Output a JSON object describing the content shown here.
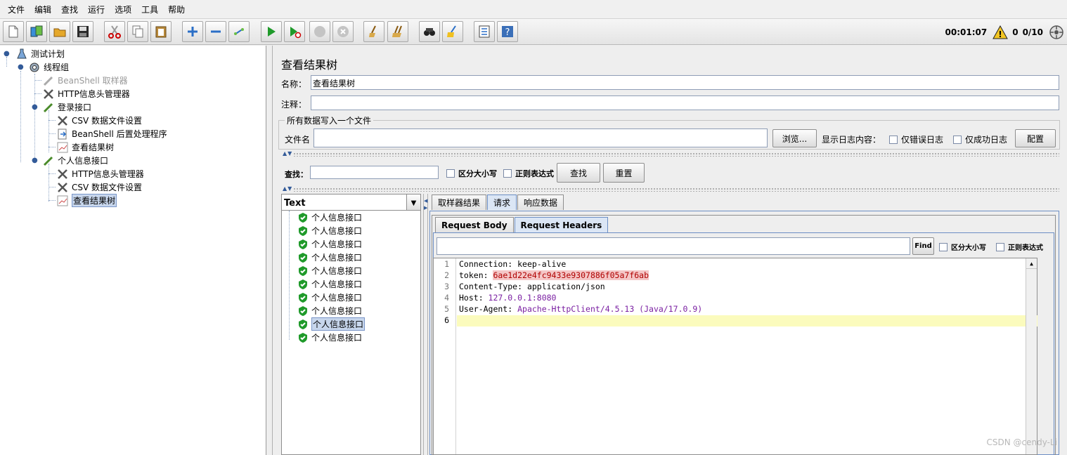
{
  "menu": [
    "文件",
    "编辑",
    "查找",
    "运行",
    "选项",
    "工具",
    "帮助"
  ],
  "toolbar": {
    "buttons": [
      "new-icon",
      "templates-icon",
      "open-icon",
      "save-icon",
      "cut-icon",
      "copy-icon",
      "paste-icon",
      "expand-icon",
      "collapse-icon",
      "toggle-icon",
      "start-icon",
      "start-no-pause-icon",
      "stop-icon",
      "shutdown-icon",
      "clear-icon",
      "clear-all-icon",
      "search-icon",
      "reset-search-icon",
      "function-helper-icon",
      "help-icon"
    ],
    "timer": "00:01:07",
    "warnings": "0",
    "threads": "0/10"
  },
  "tree": {
    "nodes": [
      {
        "label": "测试计划",
        "icon": "flask-icon",
        "depth": 0,
        "state": "normal"
      },
      {
        "label": "线程组",
        "icon": "gear-icon",
        "depth": 1,
        "state": "normal"
      },
      {
        "label": "BeanShell 取样器",
        "icon": "pipette-icon",
        "depth": 2,
        "state": "disabled"
      },
      {
        "label": "HTTP信息头管理器",
        "icon": "wrench-icon",
        "depth": 2,
        "state": "normal"
      },
      {
        "label": "登录接口",
        "icon": "pipette-icon",
        "depth": 2,
        "state": "normal"
      },
      {
        "label": "CSV 数据文件设置",
        "icon": "wrench-icon",
        "depth": 3,
        "state": "normal"
      },
      {
        "label": "BeanShell 后置处理程序",
        "icon": "post-processor-icon",
        "depth": 3,
        "state": "normal"
      },
      {
        "label": "查看结果树",
        "icon": "chart-icon",
        "depth": 3,
        "state": "normal"
      },
      {
        "label": "个人信息接口",
        "icon": "pipette-icon",
        "depth": 2,
        "state": "normal"
      },
      {
        "label": "HTTP信息头管理器",
        "icon": "wrench-icon",
        "depth": 3,
        "state": "normal"
      },
      {
        "label": "CSV 数据文件设置",
        "icon": "wrench-icon",
        "depth": 3,
        "state": "normal"
      },
      {
        "label": "查看结果树",
        "icon": "chart-icon",
        "depth": 3,
        "state": "selected"
      }
    ]
  },
  "panel": {
    "title": "查看结果树",
    "name_label": "名称：",
    "name_value": "查看结果树",
    "comment_label": "注释：",
    "comment_value": "",
    "group_title": "所有数据写入一个文件",
    "filename_label": "文件名",
    "filename_value": "",
    "browse_button": "浏览...",
    "log_label": "显示日志内容：",
    "errors_only": "仅错误日志",
    "success_only": "仅成功日志",
    "config_button": "配置"
  },
  "search": {
    "label": "查找：",
    "value": "",
    "case_sensitive": "区分大小写",
    "regex": "正则表达式",
    "find_button": "查找",
    "reset_button": "重置"
  },
  "renderer": {
    "selected": "Text"
  },
  "results": {
    "items": [
      "个人信息接口",
      "个人信息接口",
      "个人信息接口",
      "个人信息接口",
      "个人信息接口",
      "个人信息接口",
      "个人信息接口",
      "个人信息接口",
      "个人信息接口",
      "个人信息接口"
    ],
    "selected_index": 8
  },
  "tabs": [
    "取样器结果",
    "请求",
    "响应数据"
  ],
  "active_tab": "请求",
  "subtabs": [
    "Request Body",
    "Request Headers"
  ],
  "active_subtab": "Request Headers",
  "inner_search": {
    "value": "",
    "find_button": "Find",
    "case_sensitive": "区分大小写",
    "regex": "正则表达式"
  },
  "editor": {
    "lines": [
      {
        "num": "1",
        "key": "Connection: ",
        "value": "keep-alive",
        "style": "plain"
      },
      {
        "num": "2",
        "key": "token: ",
        "value": "6ae1d22e4fc9433e9307886f05a7f6ab",
        "style": "red"
      },
      {
        "num": "3",
        "key": "Content-Type: ",
        "value": "application/json",
        "style": "plain"
      },
      {
        "num": "4",
        "key": "Host: ",
        "value": "127.0.0.1:8080",
        "style": "purple"
      },
      {
        "num": "5",
        "key": "User-Agent: ",
        "value": "Apache-HttpClient/4.5.13 (Java/17.0.9)",
        "style": "mixed"
      },
      {
        "num": "6",
        "key": "",
        "value": "",
        "style": "current"
      }
    ]
  },
  "watermark": "CSDN @cendy-Li"
}
